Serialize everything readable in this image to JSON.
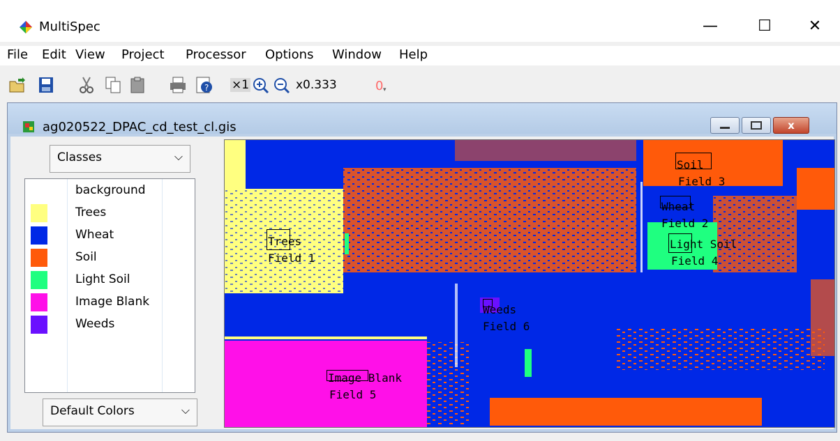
{
  "app": {
    "title": "MultiSpec"
  },
  "window_controls": {
    "minimize": "—",
    "maximize": "☐",
    "close": "✕"
  },
  "menu": [
    {
      "label": "File"
    },
    {
      "label": "Edit"
    },
    {
      "label": "View"
    },
    {
      "label": "Project"
    },
    {
      "label": "Processor"
    },
    {
      "label": "Options"
    },
    {
      "label": "Window"
    },
    {
      "label": "Help"
    }
  ],
  "toolbar": {
    "icons": [
      "open-icon",
      "save-icon",
      "cut-icon",
      "copy-icon",
      "paste-icon",
      "print-icon",
      "info-icon",
      "zoom-1x-icon",
      "zoom-in-icon",
      "zoom-out-icon",
      "overlay-icon"
    ],
    "zoom_1x_label": "×1",
    "zoom_level": "x0.333"
  },
  "child_window": {
    "title": "ag020522_DPAC_cd_test_cl.gis",
    "close_label": "x"
  },
  "panel": {
    "display_select": "Classes",
    "palette_select": "Default Colors"
  },
  "legend": [
    {
      "name": "background",
      "color": ""
    },
    {
      "name": "Trees",
      "color": "#ffff80"
    },
    {
      "name": "Wheat",
      "color": "#0028e6"
    },
    {
      "name": "Soil",
      "color": "#ff5a0a"
    },
    {
      "name": "Light Soil",
      "color": "#1fff80"
    },
    {
      "name": "Image Blank",
      "color": "#ff10e8"
    },
    {
      "name": "Weeds",
      "color": "#6a10ff"
    }
  ],
  "map_labels": {
    "trees": "Trees",
    "field1": "Field 1",
    "soil": "Soil",
    "field3": "Field 3",
    "wheat": "Wheat",
    "field2": "Field 2",
    "light_soil": "Light Soil",
    "field4": "Field 4",
    "weeds": "Weeds",
    "field6": "Field 6",
    "image_blank": "Image Blank",
    "field5": "Field 5"
  }
}
